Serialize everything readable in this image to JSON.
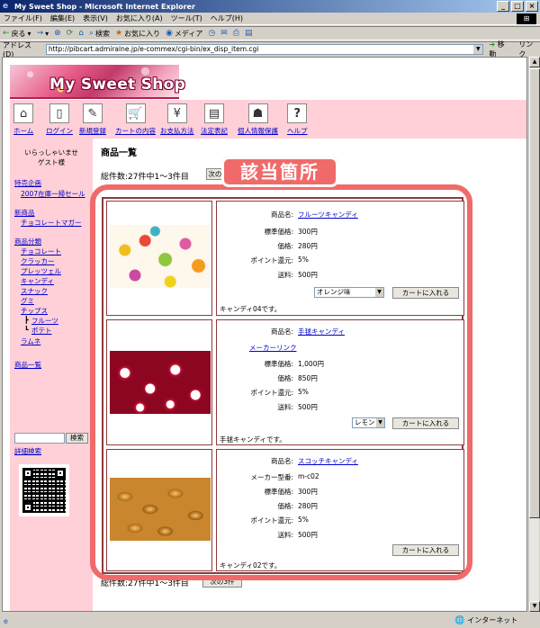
{
  "window": {
    "title": "My Sweet Shop - Microsoft Internet Explorer",
    "controls": [
      "_",
      "□",
      "×"
    ]
  },
  "menu": [
    "ファイル(F)",
    "編集(E)",
    "表示(V)",
    "お気に入り(A)",
    "ツール(T)",
    "ヘルプ(H)"
  ],
  "toolbar": {
    "back": "戻る",
    "search": "検索",
    "favorites": "お気に入り",
    "media": "メディア"
  },
  "address": {
    "label": "アドレス(D)",
    "url": "http://pibcart.admiralne.jp/e-commex/cgi-bin/ex_disp_item.cgi",
    "go": "移動",
    "links": "リンク"
  },
  "site": {
    "logo_text": "My Sweet Shop",
    "nav": [
      {
        "label": "ホーム",
        "icon": "home-icon",
        "glyph": "⌂"
      },
      {
        "label": "ログイン",
        "icon": "login-door-icon",
        "glyph": "▯"
      },
      {
        "label": "新規登録",
        "icon": "pen-icon",
        "glyph": "✎"
      },
      {
        "label": "カートの内容",
        "icon": "cart-icon",
        "glyph": "🛒"
      },
      {
        "label": "お支払方法",
        "icon": "payment-icon",
        "glyph": "¥"
      },
      {
        "label": "法定表記",
        "icon": "document-icon",
        "glyph": "▤"
      },
      {
        "label": "個人情報保護",
        "icon": "person-icon",
        "glyph": "☗"
      },
      {
        "label": "ヘルプ",
        "icon": "help-icon",
        "glyph": "?"
      }
    ],
    "sidebar": {
      "welcome_line1": "いらっしゃいませ",
      "welcome_line2": "ゲスト様",
      "special": "特売企画",
      "special_sub": "2007在庫一掃セール",
      "new_items": "新商品",
      "new_items_sub": "チョコレートマガー",
      "category": "商品分類",
      "categories": [
        "チョコレート",
        "クラッカー",
        "プレッツェル",
        "キャンディ",
        "スナック",
        "グミ",
        "チップス"
      ],
      "chips_sub": [
        "フルーツ",
        "ポテト"
      ],
      "ramune": "ラムネ",
      "product_list": "商品一覧",
      "search_button": "検索",
      "advanced_search": "詳細検索"
    },
    "main": {
      "title": "商品一覧",
      "count_text": "総件数:27件中1～3件目",
      "next_top": "次の3件",
      "next_bottom": "次の3件",
      "labels": {
        "name": "商品名:",
        "maker_no": "メーカー型番:",
        "list_price": "標準価格:",
        "price": "価格:",
        "points": "ポイント還元:",
        "shipping": "送料:"
      },
      "add_to_cart": "カートに入れる",
      "maker_link": "メーカーリンク",
      "products": [
        {
          "name": "フルーツキャンディ",
          "list_price": "300円",
          "price": "280円",
          "points": "5%",
          "shipping": "500円",
          "option": "オレンジ味",
          "desc": "キャンディ04です。"
        },
        {
          "name": "手毬キャンディ",
          "list_price": "1,000円",
          "price": "850円",
          "points": "5%",
          "shipping": "500円",
          "option": "レモン",
          "desc": "手毬キャンディです。"
        },
        {
          "name": "スコッチキャンディ",
          "maker_no": "m-c02",
          "list_price": "300円",
          "price": "280円",
          "points": "5%",
          "shipping": "500円",
          "desc": "キャンディ02です。"
        }
      ]
    },
    "annotation": "該当箇所"
  },
  "status": {
    "zone": "インターネット"
  },
  "colors": {
    "site_pink": "#ffd0d8",
    "table_border": "#8b3a3a",
    "highlight": "#f06a6a",
    "link": "#0000cc"
  }
}
